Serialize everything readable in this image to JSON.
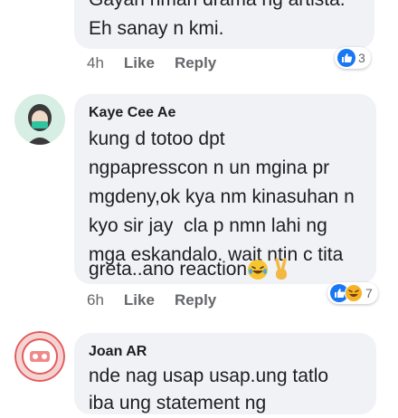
{
  "comments": [
    {
      "text_lines": [
        "Gayan nman drama ng artista.",
        "Eh sanay n kmi."
      ],
      "time": "4h",
      "like_label": "Like",
      "reply_label": "Reply",
      "reaction_count": "3",
      "reaction_icons": [
        "like-icon"
      ]
    },
    {
      "author": "Kaye Cee Ae",
      "text_lines": [
        "kung d totoo dpt",
        "ngpapresscon n un mgina pr",
        "mgdeny,ok kya nm kinasuhan n",
        "kyo sir jay  cla p nmn lahi ng",
        "mga eskandalo. wait ntin c tita",
        "greta..ano reaction"
      ],
      "text_emojis": [
        "laughing-tears-emoji",
        "victory-hand-emoji"
      ],
      "time": "6h",
      "like_label": "Like",
      "reply_label": "Reply",
      "reaction_count": "7",
      "reaction_icons": [
        "like-icon",
        "haha-icon"
      ]
    },
    {
      "author": "Joan AR",
      "text_lines": [
        "nde nag usap usap.ung tatlo",
        "iba ung statement ng"
      ]
    }
  ],
  "colors": {
    "bubble": "#f0f2f5",
    "text": "#1c1e21",
    "meta": "#65676b",
    "like_blue": "#1877f2",
    "haha_yellow": "#f7b125"
  }
}
